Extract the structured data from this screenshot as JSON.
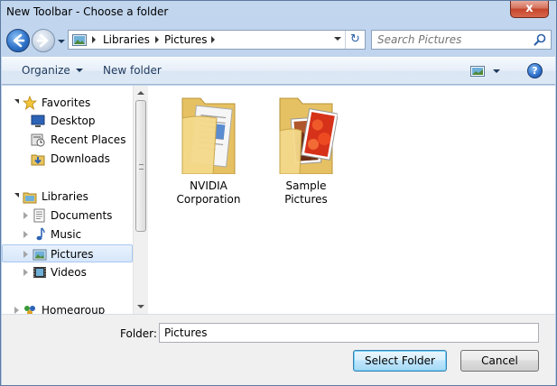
{
  "window": {
    "title": "New Toolbar - Choose a folder",
    "close_glyph": "x"
  },
  "address": {
    "breadcrumbs": [
      "Libraries",
      "Pictures"
    ],
    "refresh_glyph": "↻"
  },
  "search": {
    "placeholder": "Search Pictures"
  },
  "commandbar": {
    "organize_label": "Organize",
    "new_folder_label": "New folder",
    "help_glyph": "?"
  },
  "nav": {
    "favorites": {
      "label": "Favorites",
      "items": [
        {
          "label": "Desktop",
          "icon": "desktop-icon"
        },
        {
          "label": "Recent Places",
          "icon": "recent-places-icon"
        },
        {
          "label": "Downloads",
          "icon": "downloads-icon"
        }
      ]
    },
    "libraries": {
      "label": "Libraries",
      "items": [
        {
          "label": "Documents",
          "icon": "documents-icon"
        },
        {
          "label": "Music",
          "icon": "music-icon"
        },
        {
          "label": "Pictures",
          "icon": "pictures-icon",
          "selected": true
        },
        {
          "label": "Videos",
          "icon": "videos-icon"
        }
      ]
    },
    "homegroup": {
      "label": "Homegroup"
    }
  },
  "content": {
    "folders": [
      {
        "label": "NVIDIA Corporation",
        "icon": "folder-documents-icon"
      },
      {
        "label": "Sample Pictures",
        "icon": "folder-pictures-icon"
      }
    ]
  },
  "footer": {
    "folder_label": "Folder:",
    "folder_value": "Pictures",
    "select_button": "Select Folder",
    "cancel_button": "Cancel"
  },
  "colors": {
    "selection": "#d7e7fa",
    "accent_blue": "#2f73c9",
    "close_red": "#c5452a"
  }
}
